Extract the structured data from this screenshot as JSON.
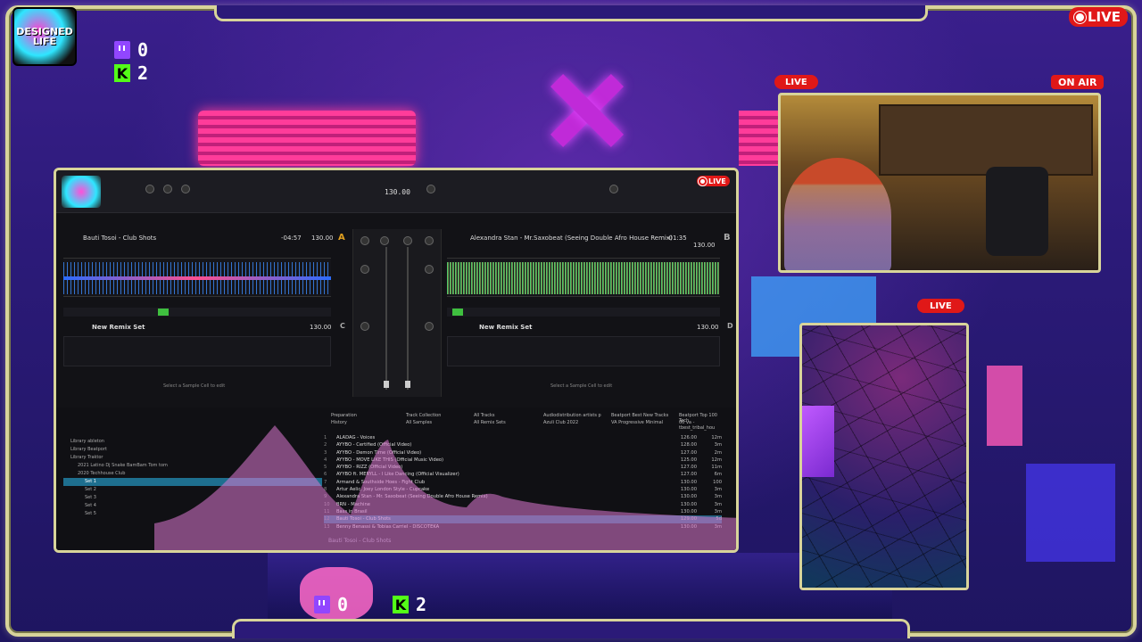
{
  "overlay": {
    "logo_text": "DESIGNED LIFE",
    "twitch_count_top": "0",
    "kick_count_top": "2",
    "twitch_count_bottom": "0",
    "kick_count_bottom": "2",
    "live_top_right": "LIVE",
    "live_cam": "LIVE",
    "on_air": "ON AIR",
    "live_cam2": "LIVE",
    "live_dj": "LIVE"
  },
  "dj": {
    "master_bpm": "130.00",
    "deck_a": {
      "title": "Bauti Tosoi - Club Shots",
      "time": "-04:57",
      "bpm": "130.00",
      "letter": "A"
    },
    "deck_b": {
      "title": "Alexandra Stan - Mr.Saxobeat (Seeing Double Afro House Remix)",
      "time": "-01:35",
      "bpm": "130.00",
      "letter": "B"
    },
    "deck_c": {
      "title": "New Remix Set",
      "bpm": "130.00",
      "letter": "C"
    },
    "deck_d": {
      "title": "New Remix Set",
      "bpm": "130.00",
      "letter": "D"
    },
    "sample_hint_left": "Select a Sample Cell to edit",
    "sample_hint_right": "Select a Sample Cell to edit",
    "browser": {
      "tabs": [
        "Preparation",
        "History",
        "Track Collection",
        "All Tracks",
        "All Samples",
        "All Remix Sets",
        "Audiodistribution artists p",
        "Beatport Best New Tracks",
        "Beatport Top 100 Tech",
        "Azuli Club 2022",
        "VA Progressive Minimal",
        "00 va - tbest_tribal_hou"
      ],
      "tree": [
        "Library ableton",
        "Library Beatport",
        "Library Traktor",
        "2021 Latino Dj Snake BamBam Tom tom",
        "2020 Techhouse Club",
        "Set 1",
        "Set 2",
        "Set 3",
        "Set 4",
        "Set 5"
      ],
      "tree_selected_index": 5,
      "tracks": [
        {
          "num": "1",
          "title": "ALADAG - Voices",
          "bpm": "126.00",
          "len": "12m"
        },
        {
          "num": "2",
          "title": "AYYBO - Certified (Official Video)",
          "bpm": "128.00",
          "len": "3m"
        },
        {
          "num": "3",
          "title": "AYYBO - Demon Time (Official Video)",
          "bpm": "127.00",
          "len": "2m"
        },
        {
          "num": "4",
          "title": "AYYBO - MOVE LIKE THIS (Official Music Video)",
          "bpm": "125.00",
          "len": "12m"
        },
        {
          "num": "5",
          "title": "AYYBO - RIZZ (Official Video)",
          "bpm": "127.00",
          "len": "11m"
        },
        {
          "num": "6",
          "title": "AYYBO ft. MERYLL - I Like Dancing (Official Visualizer)",
          "bpm": "127.00",
          "len": "6m"
        },
        {
          "num": "7",
          "title": "Armand & Southside Hoes - Fight Club",
          "bpm": "130.00",
          "len": "100"
        },
        {
          "num": "8",
          "title": "Artur Aelic, Joey London Style - Cupcake",
          "bpm": "130.00",
          "len": "3m"
        },
        {
          "num": "9",
          "title": "Alexandra Stan - Mr. Saxobeat (Seeing Double Afro House Remix)",
          "bpm": "130.00",
          "len": "3m"
        },
        {
          "num": "10",
          "title": "BRN - Machine",
          "bpm": "130.00",
          "len": "3m"
        },
        {
          "num": "11",
          "title": "Bass in Brasil",
          "bpm": "130.00",
          "len": "3m"
        },
        {
          "num": "12",
          "title": "Bauti Tosoi - Club Shots",
          "bpm": "129.00",
          "len": "5d"
        },
        {
          "num": "13",
          "title": "Benny Benassi & Tobias Carriel - DISCOTEKA",
          "bpm": "130.00",
          "len": "3m"
        }
      ],
      "highlight_index": 11,
      "footer_track": "Bauti Tosoi - Club Shots"
    }
  },
  "colors": {
    "frame_gold": "#d8d49a",
    "live_red": "#e01818",
    "twitch_purple": "#9146ff",
    "kick_green": "#53fc18"
  }
}
